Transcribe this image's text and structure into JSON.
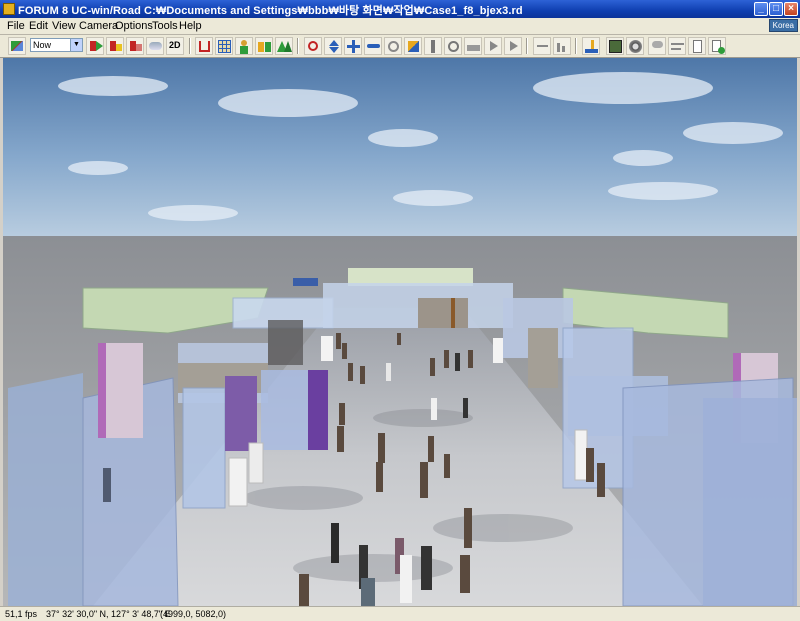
{
  "window": {
    "title": "FORUM 8   UC-win/Road    C:₩Documents and Settings₩bbb₩바탕 화면₩작업₩Case1_f8_bjex3.rd",
    "minimize": "_",
    "maximize": "□",
    "close": "×"
  },
  "menu": {
    "items": [
      "File",
      "Edit",
      "View",
      "Camera",
      "Options",
      "Tools",
      "Help"
    ],
    "language_badge": "Korea"
  },
  "toolbar": {
    "time_select": "Now",
    "view_2d_label": "2D",
    "icons": [
      "road-edit-icon",
      "traffic-start-icon",
      "traffic-stop-icon",
      "traffic-pause-icon",
      "fog-icon",
      "view-2d-icon",
      "road-alignment-icon",
      "grid-icon",
      "pedestrian-icon",
      "crowd-icon",
      "trees-icon",
      "move-icon",
      "up-down-icon",
      "pan-icon",
      "fly-icon",
      "rotate-icon",
      "edit-object-icon",
      "walk-icon",
      "target-icon",
      "camera-path-icon",
      "play-icon",
      "record-icon",
      "measure-icon",
      "chart-icon",
      "paint-icon",
      "render-icon",
      "drive-icon",
      "rain-icon",
      "wind-icon",
      "document-icon",
      "add-model-icon"
    ],
    "colors": {
      "accent": "#c22424",
      "green": "#2e9c3a",
      "blue": "#2a5fb8"
    }
  },
  "status": {
    "fps": "51,1 fps",
    "geo": "37° 32' 30,0\" N, 127° 3' 48,7\" E",
    "coords": "(4999,0, 5082,0)"
  }
}
